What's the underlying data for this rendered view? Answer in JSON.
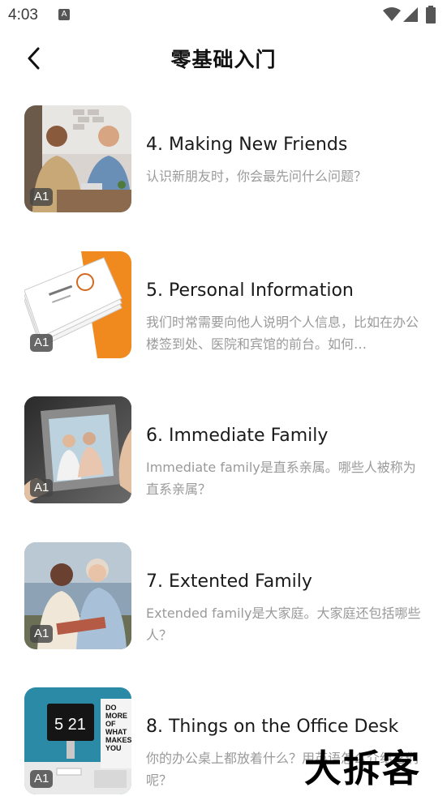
{
  "status_bar": {
    "time": "4:03",
    "notification_icon": "A"
  },
  "header": {
    "title": "零基础入门",
    "back_icon": "chevron-left"
  },
  "lessons": [
    {
      "title": "4. Making New Friends",
      "description": "认识新朋友时，你会最先问什么问题？",
      "level": "A1"
    },
    {
      "title": "5. Personal Information",
      "description": "我们时常需要向他人说明个人信息，比如在办公楼签到处、医院和宾馆的前台。如何…",
      "level": "A1"
    },
    {
      "title": "6. Immediate Family",
      "description": "Immediate family是直系亲属。哪些人被称为直系亲属？",
      "level": "A1"
    },
    {
      "title": "7. Extented Family",
      "description": "Extended family是大家庭。大家庭还包括哪些人？",
      "level": "A1"
    },
    {
      "title": "8. Things on the Office Desk",
      "description": "你的办公桌上都放着什么？用英语怎么介绍它们呢？",
      "level": "A1"
    }
  ],
  "watermark": "大拆客"
}
